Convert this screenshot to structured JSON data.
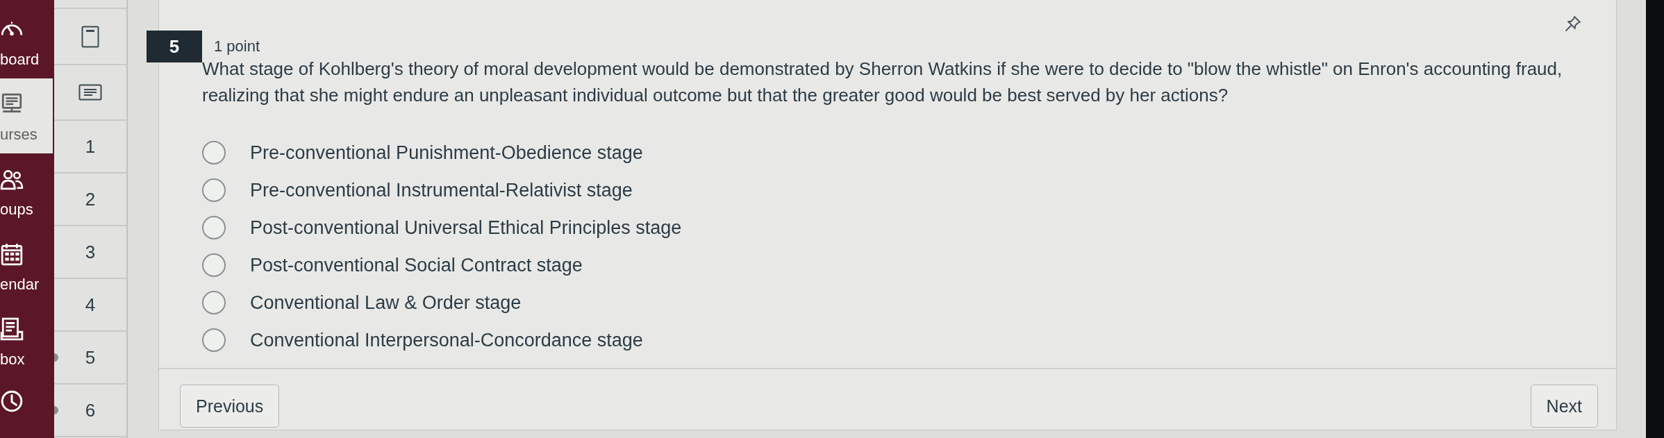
{
  "sidebar": {
    "items": [
      {
        "label": "board",
        "selected": false
      },
      {
        "label": "urses",
        "selected": true
      },
      {
        "label": "oups",
        "selected": false
      },
      {
        "label": "endar",
        "selected": false
      },
      {
        "label": "box",
        "selected": false
      },
      {
        "selected": false
      }
    ]
  },
  "question_nav": {
    "items": [
      {
        "number": "1",
        "marked": false
      },
      {
        "number": "2",
        "marked": false
      },
      {
        "number": "3",
        "marked": false
      },
      {
        "number": "4",
        "marked": false
      },
      {
        "number": "5",
        "marked": true
      },
      {
        "number": "6",
        "marked": true
      }
    ]
  },
  "question": {
    "number": "5",
    "points": "1 point",
    "text": "What stage of Kohlberg's theory of moral development would be demonstrated by Sherron Watkins if she were to decide to \"blow the whistle\" on Enron's accounting fraud, realizing that she might endure an unpleasant individual outcome but that the greater good would be best served by her actions?",
    "options": [
      {
        "label": "Pre-conventional Punishment-Obedience stage",
        "selected": false
      },
      {
        "label": "Pre-conventional Instrumental-Relativist stage",
        "selected": false
      },
      {
        "label": "Post-conventional Universal Ethical Principles stage",
        "selected": false
      },
      {
        "label": "Post-conventional Social Contract stage",
        "selected": false
      },
      {
        "label": "Conventional Law & Order stage",
        "selected": false
      },
      {
        "label": "Conventional Interpersonal-Concordance stage",
        "selected": false
      }
    ]
  },
  "footer": {
    "previous": "Previous",
    "next": "Next"
  }
}
